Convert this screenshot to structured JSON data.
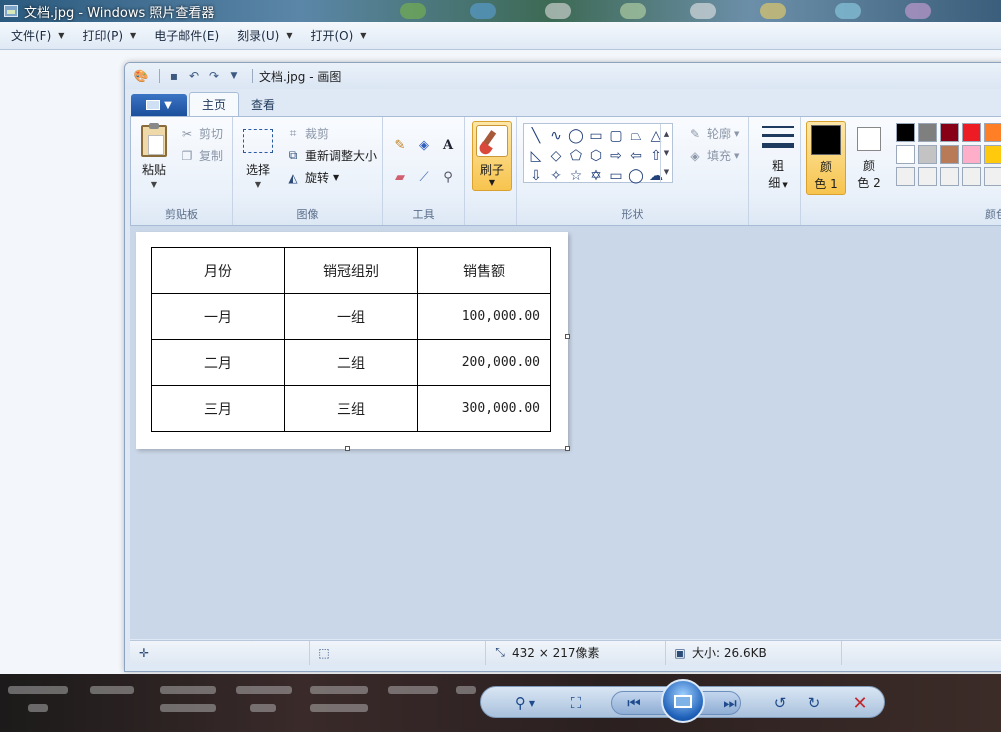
{
  "viewer": {
    "title": "文档.jpg - Windows 照片查看器",
    "menu": [
      {
        "label": "文件(F)",
        "has_caret": true
      },
      {
        "label": "打印(P)",
        "has_caret": true
      },
      {
        "label": "电子邮件(E)",
        "has_caret": false
      },
      {
        "label": "刻录(U)",
        "has_caret": true
      },
      {
        "label": "打开(O)",
        "has_caret": true
      }
    ]
  },
  "paint": {
    "window_title": "文档.jpg - 画图",
    "tabs": [
      "主页",
      "查看"
    ],
    "groups": {
      "clipboard": {
        "label": "剪贴板",
        "paste": "粘贴",
        "cut": "剪切",
        "copy": "复制"
      },
      "image": {
        "label": "图像",
        "select": "选择",
        "crop": "裁剪",
        "resize": "重新调整大小",
        "rotate": "旋转"
      },
      "tools": {
        "label": "工具"
      },
      "brush": {
        "label": "刷子"
      },
      "shapes": {
        "label": "形状",
        "outline": "轮廓",
        "fill": "填充"
      },
      "size": {
        "label_line1": "粗",
        "label_line2": "细"
      },
      "color1": {
        "line1": "颜",
        "line2": "色 1",
        "color": "#000000"
      },
      "color2": {
        "line1": "颜",
        "line2": "色 2",
        "color": "#ffffff"
      },
      "colors": {
        "label": "颜色"
      }
    },
    "palette": [
      "#000000",
      "#7f7f7f",
      "#880015",
      "#ed1c24",
      "#ff7f27",
      "#ffffff",
      "#c3c3c3",
      "#b97a57",
      "#ffaec9",
      "#ffc90e",
      "#f0f0f0",
      "#f0f0f0",
      "#f0f0f0",
      "#f0f0f0",
      "#f0f0f0"
    ],
    "table": {
      "headers": [
        "月份",
        "销冠组别",
        "销售额"
      ],
      "rows": [
        [
          "一月",
          "一组",
          "100,000.00"
        ],
        [
          "二月",
          "二组",
          "200,000.00"
        ],
        [
          "三月",
          "三组",
          "300,000.00"
        ]
      ]
    },
    "status": {
      "dimensions": "432 × 217像素",
      "size": "大小: 26.6KB"
    }
  }
}
